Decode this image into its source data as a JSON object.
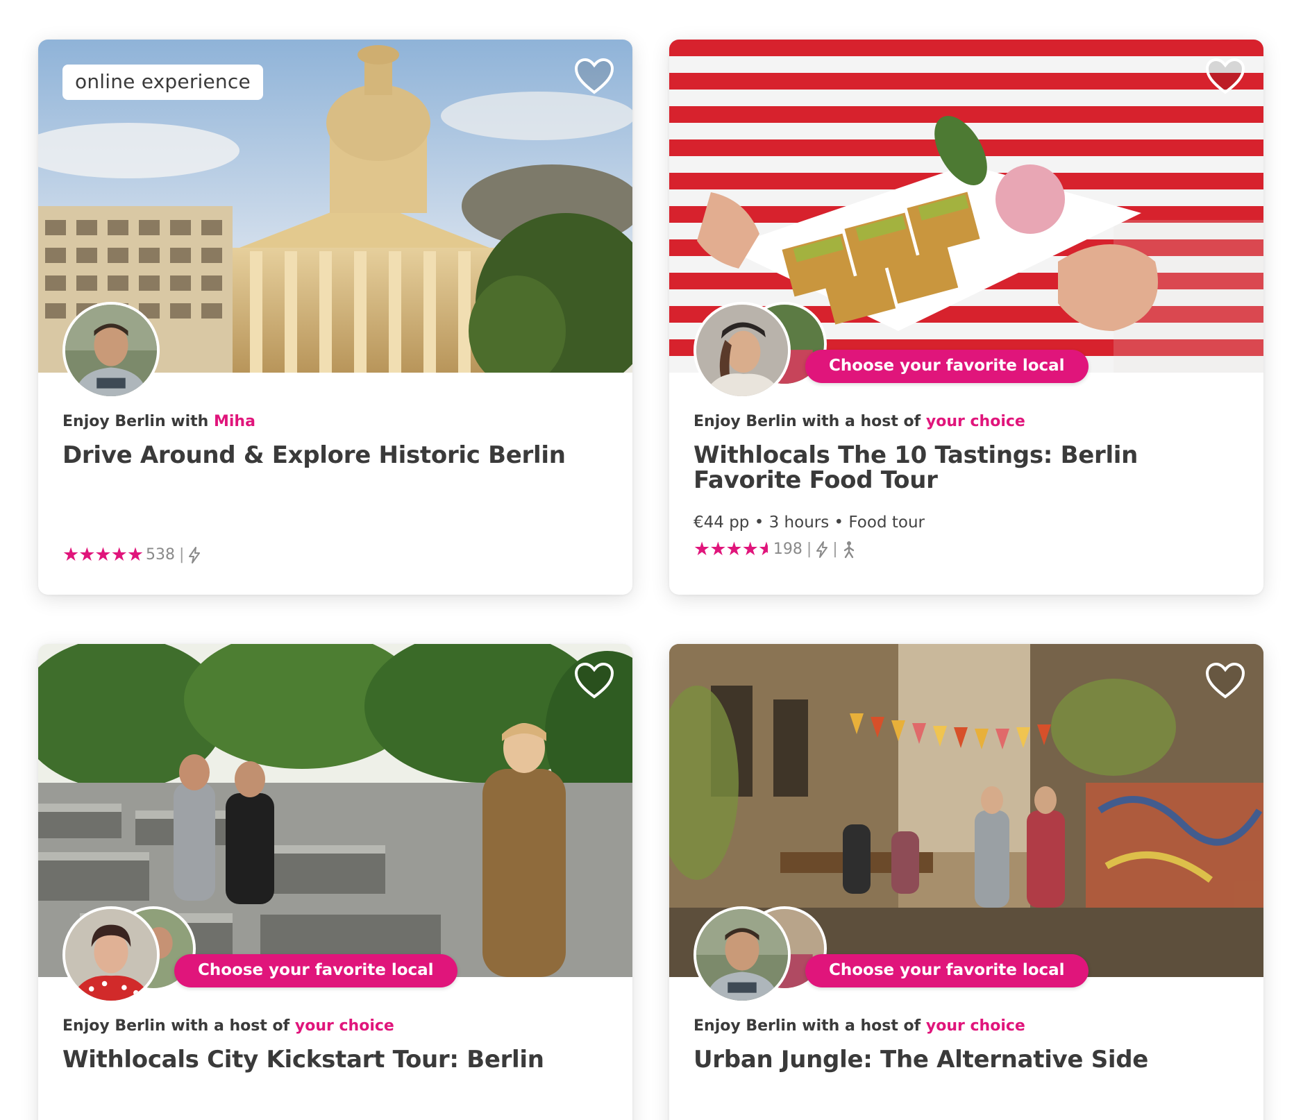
{
  "colors": {
    "accent": "#e0157b",
    "text": "#3a3a3a",
    "muted": "#8a8a8a"
  },
  "cards": [
    {
      "badge": "online experience",
      "host_prefix": "Enjoy Berlin with ",
      "host_highlight": "Miha",
      "title": "Drive Around & Explore Historic Berlin",
      "meta": "",
      "stars": "★★★★★",
      "rating_value": 5.0,
      "review_count": "538",
      "sep": "|",
      "icons": [
        "instant-booking-icon"
      ],
      "favorite": false
    },
    {
      "badge": "",
      "pill": "Choose your favorite local",
      "host_prefix": "Enjoy Berlin with a host of ",
      "host_highlight": "your choice",
      "title": "Withlocals The 10 Tastings: Berlin Favorite Food Tour",
      "meta": "€44 pp • 3 hours • Food tour",
      "stars": "★★★★",
      "rating_value": 4.5,
      "review_count": "198",
      "sep": "|",
      "icons": [
        "instant-booking-icon",
        "walking-icon"
      ],
      "favorite": false
    },
    {
      "pill": "Choose your favorite local",
      "host_prefix": "Enjoy Berlin with a host of ",
      "host_highlight": "your choice",
      "title": "Withlocals City Kickstart Tour: Berlin",
      "favorite": false
    },
    {
      "pill": "Choose your favorite local",
      "host_prefix": "Enjoy Berlin with a host of ",
      "host_highlight": "your choice",
      "title": "Urban Jungle: The Alternative Side",
      "favorite": false
    }
  ]
}
